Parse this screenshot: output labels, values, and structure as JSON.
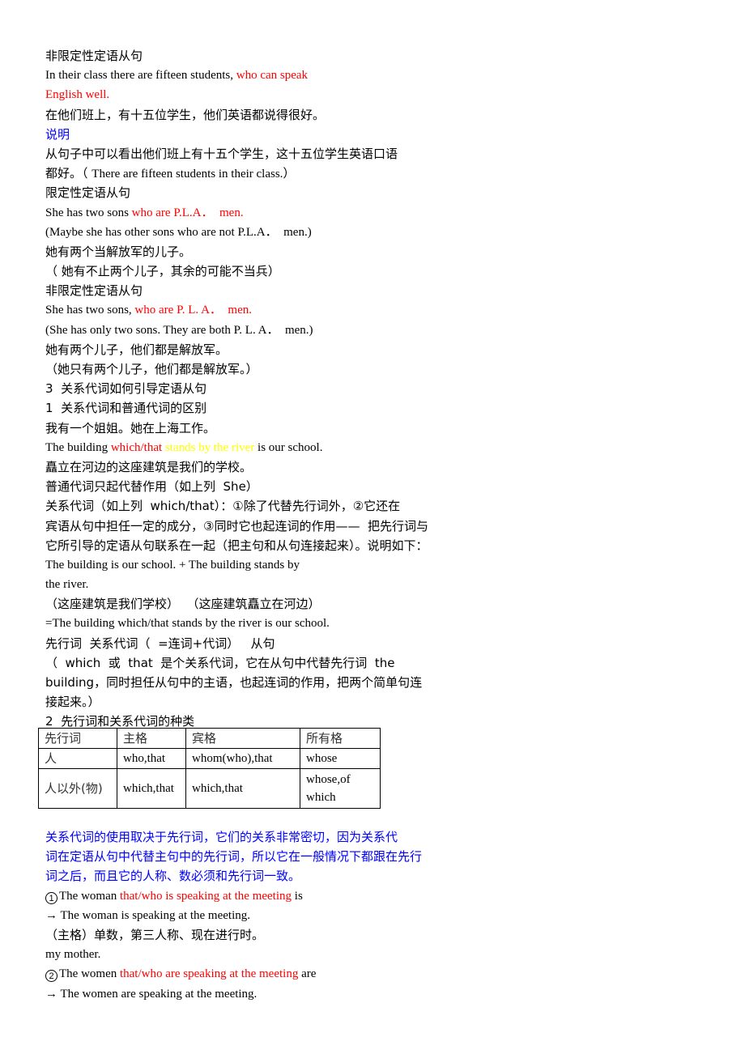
{
  "section1": {
    "heading": "非限定性定语从句",
    "example_plain": "In their class there are fifteen students, ",
    "example_red_1": "who can speak",
    "example_red_2": "English well.",
    "translation": "在他们班上，有十五位学生，他们英语都说得很好。",
    "note_label": "说明",
    "note_line1": "从句子中可以看出他们班上有十五个学生，这十五位学生英语口语",
    "note_line2_cn": "都好。（ ",
    "note_line2_en": "There are fifteen students in their class.）"
  },
  "section2": {
    "heading": "限定性定语从句",
    "ex_plain": "She has two sons ",
    "ex_red": "who are P.L.A．  men.",
    "ex_note": "(Maybe she has other sons who are not P.L.A．  men.)",
    "translation": "她有两个当解放军的儿子。",
    "translation_note": "（ 她有不止两个儿子，其余的可能不当兵）"
  },
  "section3": {
    "heading": "非限定性定语从句",
    "ex_plain": "She has two sons, ",
    "ex_red": "who are P. L. A．  men.",
    "ex_note": "(She has only two sons. They are both P. L. A．  men.)",
    "translation": "她有两个儿子，他们都是解放军。",
    "translation_note": "（她只有两个儿子，他们都是解放军。）"
  },
  "section4": {
    "heading_main": "3  关系代词如何引导定语从句",
    "heading_sub": "1  关系代词和普通代词的区别",
    "example_cn": "我有一个姐姐。她在上海工作。",
    "building_plain_1": "The building ",
    "building_red": "which/that ",
    "building_yellow": "stands by the river ",
    "building_plain_2": "is our school.",
    "building_translation": "矗立在河边的这座建筑是我们的学校。",
    "ordinary_pronoun": "普通代词只起代替作用（如上列  She）",
    "relative_line1": "关系代词（如上列  which/that）：①除了代替先行词外，②它还在",
    "relative_line2": "宾语从句中担任一定的成分，③同时它也起连词的作用——  把先行词与",
    "relative_line3": "它所引导的定语从句联系在一起（把主句和从句连接起来）。说明如下：",
    "combine_line1": "The building is our school. + The building stands by",
    "combine_line2": "the river.",
    "combine_translation": "（这座建筑是我们学校）  （这座建筑矗立在河边）",
    "combined": "=The building which/that stands by the river is our school.",
    "structure": "先行词  关系代词（  =连词+代词）   从句",
    "explain_line1": "（  which  或  that  是个关系代词，它在从句中代替先行词  the",
    "explain_line2": "building，同时担任从句中的主语，也起连词的作用，把两个简单句连",
    "explain_line3": "接起来。）",
    "kinds_heading": "2  先行词和关系代词的种类"
  },
  "table": {
    "headers": [
      "先行词",
      "主格",
      "宾格",
      "所有格"
    ],
    "rows": [
      [
        "人",
        "who,that",
        "whom(who),that",
        "whose"
      ],
      [
        "人以外(物)",
        "which,that",
        "which,that",
        "whose,of which"
      ]
    ]
  },
  "section5": {
    "blue_line1": "关系代词的使用取决于先行词，它们的关系非常密切，因为关系代",
    "blue_line2": "词在定语从句中代替主句中的先行词，所以它在一般情况下都跟在先行",
    "blue_line3": "词之后，而且它的人称、数必须和先行词一致。",
    "ex1_num": "1",
    "ex1_plain": "The woman ",
    "ex1_red": "that/who is speaking at the meeting",
    "ex1_tail": " is",
    "ex1_arrow": "→ The woman is speaking at the meeting.",
    "ex1_note": "（主格）单数，第三人称、现在进行时。",
    "ex1_end": "my mother.",
    "ex2_num": "2",
    "ex2_plain": "The women ",
    "ex2_red": "that/who are speaking at the meeting",
    "ex2_tail": " are",
    "ex2_arrow": "→ The women are speaking at the meeting."
  },
  "colors": {
    "highlight_red": "#ff0000",
    "highlight_yellow": "#ffff00",
    "note_blue": "#0000ff",
    "text": "#000000"
  }
}
